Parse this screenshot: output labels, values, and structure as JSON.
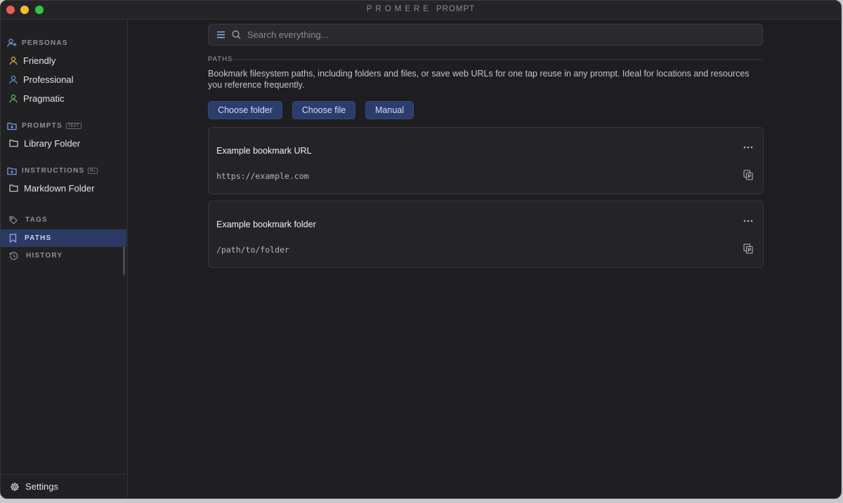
{
  "window": {
    "brand": "PROMERE",
    "app_name": "PROMPT"
  },
  "sidebar": {
    "personas": {
      "heading": "PERSONAS",
      "items": [
        {
          "label": "Friendly",
          "color": "#e8a23a"
        },
        {
          "label": "Professional",
          "color": "#5a8fe6"
        },
        {
          "label": "Pragmatic",
          "color": "#4bbf5a"
        }
      ]
    },
    "prompts": {
      "heading": "PROMPTS",
      "badge": "TEXT",
      "folder": "Library Folder"
    },
    "instructions": {
      "heading": "INSTRUCTIONS",
      "badge": "M↓",
      "folder": "Markdown Folder"
    },
    "links": {
      "tags": "TAGS",
      "paths": "PATHS",
      "history": "HISTORY"
    },
    "settings": "Settings"
  },
  "main": {
    "search": {
      "placeholder": "Search everything..."
    },
    "section_title": "PATHS",
    "description": "Bookmark filesystem paths, including folders and files, or save web URLs for one tap reuse in any prompt. Ideal for locations and resources you reference frequently.",
    "buttons": {
      "choose_folder": "Choose folder",
      "choose_file": "Choose file",
      "manual": "Manual"
    },
    "bookmarks": [
      {
        "title": "Example bookmark URL",
        "path": "https://example.com"
      },
      {
        "title": "Example bookmark folder",
        "path": "/path/to/folder"
      }
    ]
  },
  "colors": {
    "accent": "#2b3d6c",
    "active_nav": "#2a3a63",
    "background": "#1e1e21"
  }
}
